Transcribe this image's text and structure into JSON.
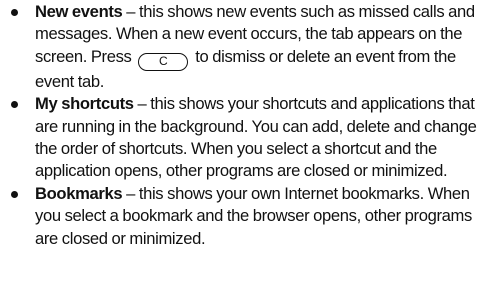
{
  "items": [
    {
      "term": "New events",
      "text_before_key": " – this shows new events such as missed calls and messages. When a new event occurs, the tab appears on the screen. Press",
      "key": "C",
      "text_after_key": "to dismiss or delete an event from the event tab."
    },
    {
      "term": "My shortcuts",
      "text": " – this shows your shortcuts and applications that are running in the background. You can add, delete and change the order of shortcuts. When you select a shortcut and the application opens, other programs are closed or minimized."
    },
    {
      "term": "Bookmarks",
      "text": " – this shows your own Internet bookmarks. When you select a bookmark and the browser opens, other programs are closed or minimized."
    }
  ]
}
